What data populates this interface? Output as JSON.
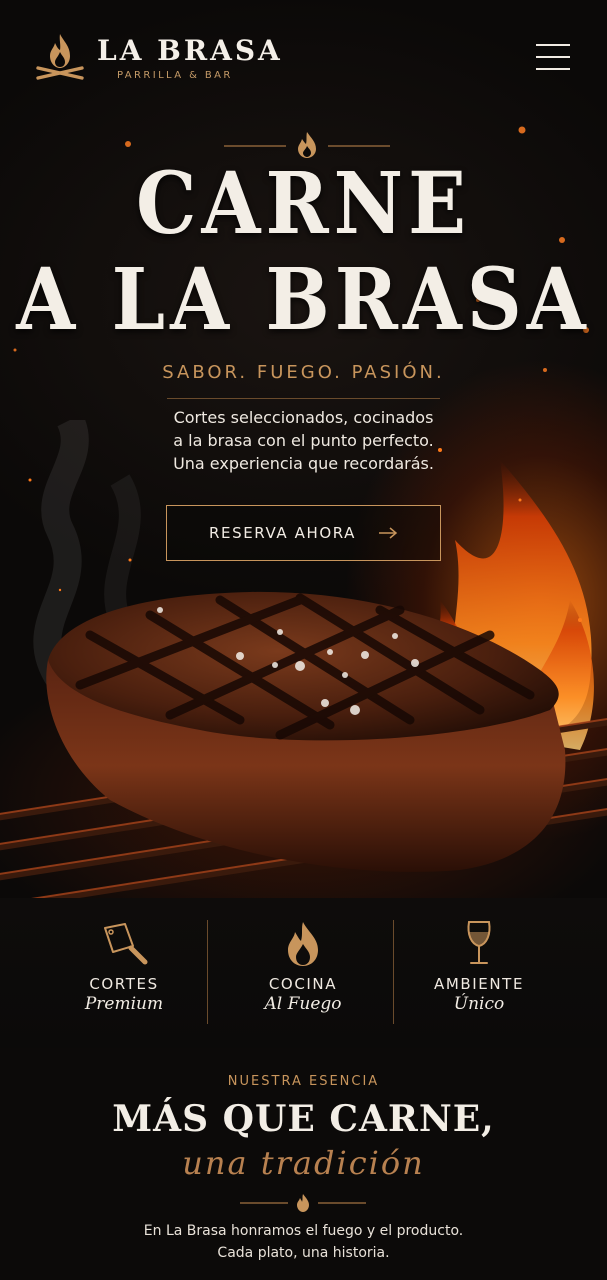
{
  "brand": {
    "name": "LA BRASA",
    "subtitle": "PARRILLA & BAR",
    "logo_icon": "flame-crossed-logs-icon"
  },
  "header": {
    "menu_icon": "hamburger-menu-icon"
  },
  "hero": {
    "title_line1": "CARNE",
    "title_line2": "A LA BRASA",
    "tagline": "SABOR. FUEGO. PASIÓN.",
    "description": [
      "Cortes seleccionados, cocinados",
      "a la brasa con el punto perfecto.",
      "Una experiencia que recordarás."
    ],
    "cta_label": "RESERVA AHORA",
    "cta_icon": "arrow-right-icon",
    "image": "grilled-steak-with-flames"
  },
  "features": [
    {
      "icon": "cleaver-icon",
      "title": "CORTES",
      "subtitle": "Premium"
    },
    {
      "icon": "flame-icon",
      "title": "COCINA",
      "subtitle": "Al Fuego"
    },
    {
      "icon": "wine-glass-icon",
      "title": "AMBIENTE",
      "subtitle": "Único"
    }
  ],
  "essence": {
    "eyebrow": "NUESTRA ESENCIA",
    "title": "MÁS QUE CARNE,",
    "script": "una tradición",
    "description": [
      "En La Brasa honramos el fuego y el producto.",
      "Cada plato, una historia."
    ]
  },
  "colors": {
    "accent": "#c8955c",
    "background": "#0b0908",
    "text": "#f2ece4"
  }
}
